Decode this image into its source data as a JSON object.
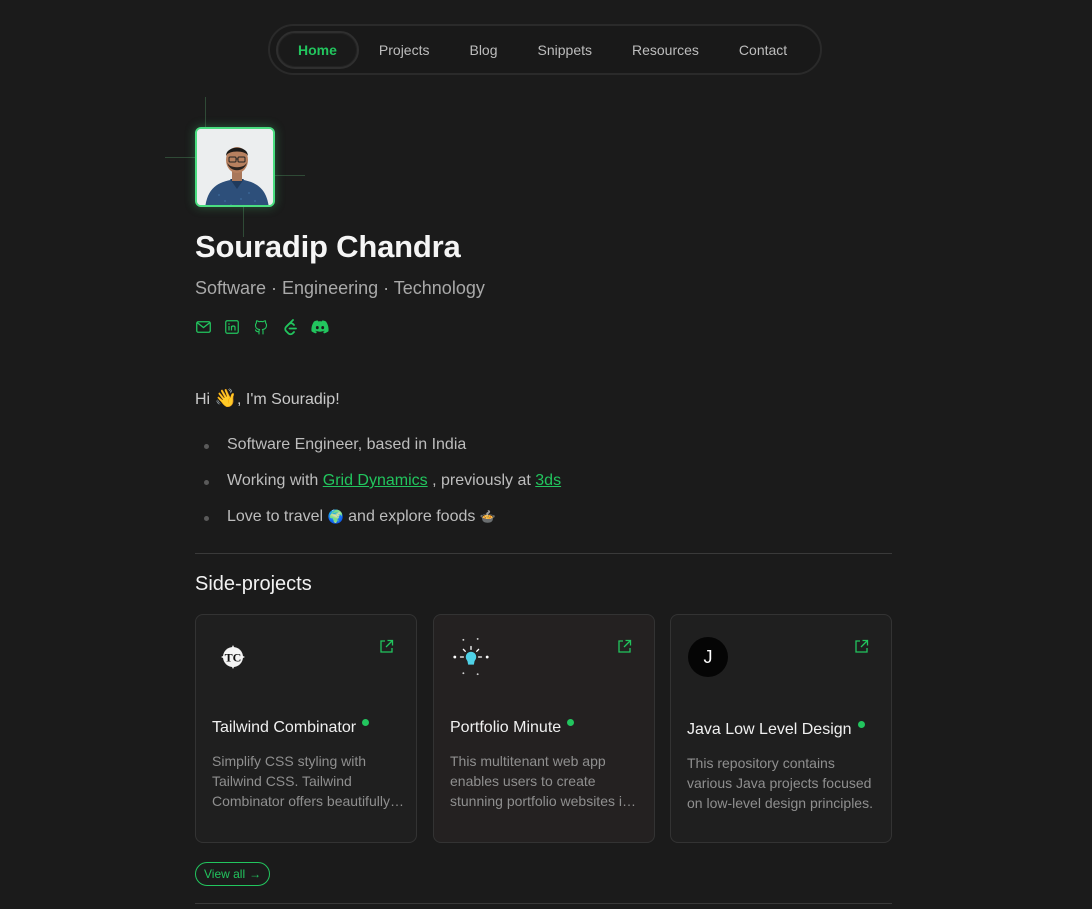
{
  "nav": {
    "items": [
      {
        "label": "Home",
        "active": true
      },
      {
        "label": "Projects"
      },
      {
        "label": "Blog"
      },
      {
        "label": "Snippets"
      },
      {
        "label": "Resources"
      },
      {
        "label": "Contact"
      }
    ]
  },
  "profile": {
    "name": "Souradip Chandra",
    "tagline": "Software · Engineering · Technology",
    "socials": [
      "mail-icon",
      "linkedin-icon",
      "github-icon",
      "leetcode-icon",
      "discord-icon"
    ]
  },
  "intro": {
    "greeting_prefix": "Hi",
    "greeting_emoji": "👋",
    "greeting_suffix": ", I'm Souradip!",
    "bullets": {
      "b1": "Software Engineer, based in India",
      "b2_prefix": "Working with",
      "b2_link1": "Grid Dynamics",
      "b2_middle": ", previously at",
      "b2_link2": "3ds",
      "b3_prefix": "Love to travel",
      "b3_emoji1": "🌍",
      "b3_middle": "and explore foods",
      "b3_emoji2": "🍲"
    }
  },
  "side_projects": {
    "heading": "Side-projects",
    "cards": [
      {
        "title": "Tailwind Combinator",
        "description": "Simplify CSS styling with Tailwind CSS. Tailwind Combinator offers beautifully crafted combinations.",
        "logo": "tc-logo-icon"
      },
      {
        "title": "Portfolio Minute",
        "description": "This multitenant web app enables users to create stunning portfolio websites in minutes.",
        "logo": "sparkle-bulb-icon"
      },
      {
        "title": "Java Low Level Design",
        "description": "This repository contains various Java projects focused on low-level design principles.",
        "logo_letter": "J"
      }
    ],
    "view_all": "View all",
    "view_all_arrow": "→"
  },
  "colors": {
    "accent": "#22c55e",
    "background": "#1b1b1b"
  }
}
